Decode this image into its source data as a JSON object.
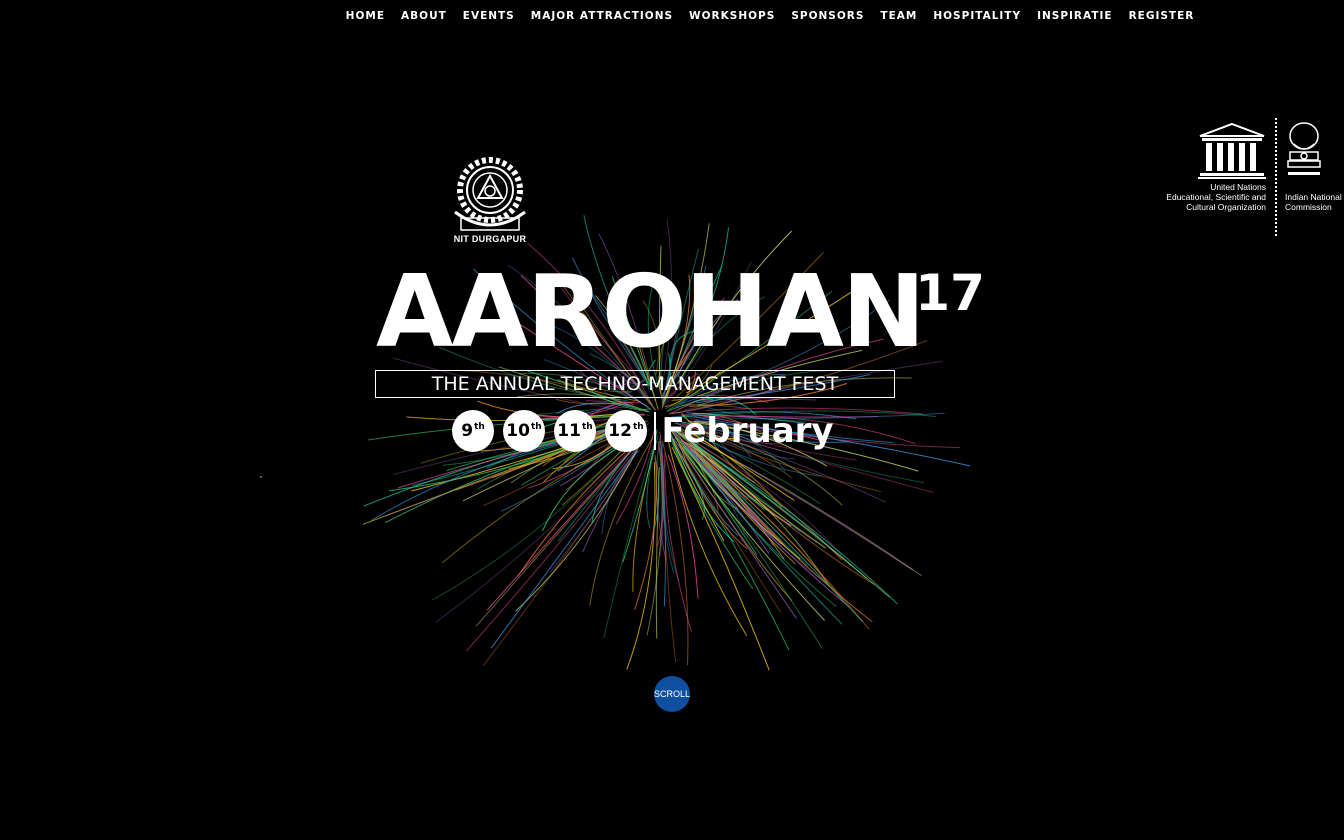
{
  "nav": {
    "items": [
      "HOME",
      "ABOUT",
      "EVENTS",
      "MAJOR ATTRACTIONS",
      "WORKSHOPS",
      "SPONSORS",
      "TEAM",
      "HOSPITALITY",
      "INSPIRATIE",
      "REGISTER"
    ]
  },
  "hero": {
    "institute_label": "NIT DURGAPUR",
    "title": "AAROHAN",
    "year": "'17",
    "tagline": "THE ANNUAL TECHNO-MANAGEMENT FEST",
    "dates": [
      {
        "day": "9",
        "suffix": "th"
      },
      {
        "day": "10",
        "suffix": "th"
      },
      {
        "day": "11",
        "suffix": "th"
      },
      {
        "day": "12",
        "suffix": "th"
      }
    ],
    "month": "February"
  },
  "unesco": {
    "logo_text": "UNESCO",
    "org_lines": [
      "United Nations",
      "Educational, Scientific and",
      "Cultural Organization"
    ],
    "commission_lines": [
      "Indian National",
      "Commission"
    ]
  },
  "scroll_label": "SCROLL",
  "colors": {
    "background": "#000000",
    "text": "#ffffff",
    "scroll_button": "#0e4fa0",
    "burst_palette": [
      "#2ecc71",
      "#9b59b6",
      "#3498db",
      "#e67e22",
      "#f1c40f",
      "#1abc9c",
      "#e84393",
      "#c8d65b"
    ]
  }
}
